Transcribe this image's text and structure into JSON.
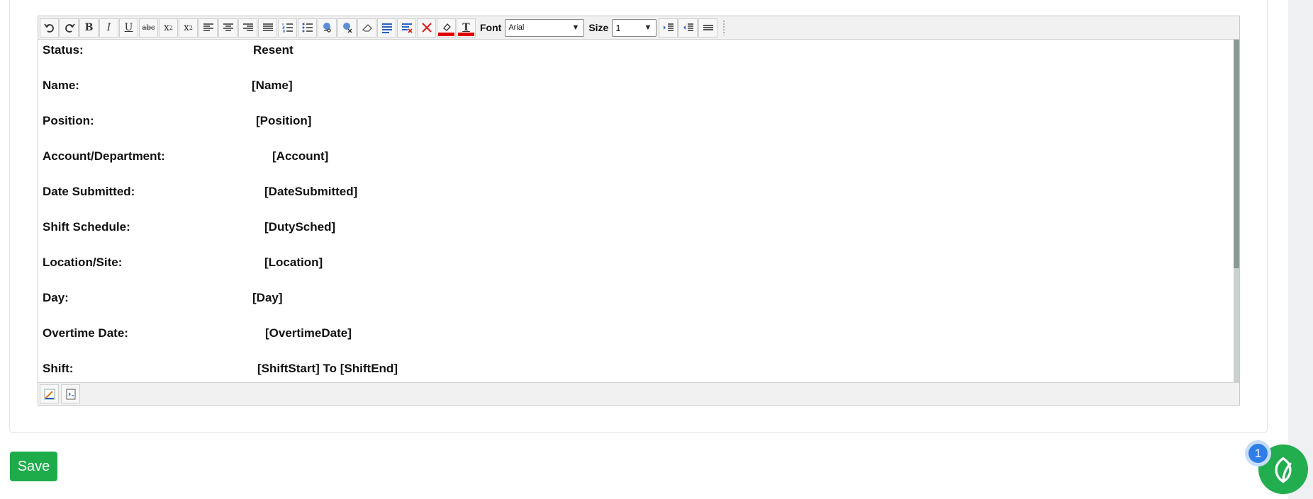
{
  "toolbar": {
    "font_label": "Font",
    "font_value": "Arial",
    "size_label": "Size",
    "size_value": "1",
    "text_color": "#e00000",
    "highlight_color": "#e00000"
  },
  "fields": [
    {
      "label": "Status:",
      "value": "Resent"
    },
    {
      "label": "Name:",
      "value": "[Name]"
    },
    {
      "label": "Position:",
      "value": "[Position]"
    },
    {
      "label": "Account/Department:",
      "value": "[Account]"
    },
    {
      "label": "Date Submitted:",
      "value": "[DateSubmitted]"
    },
    {
      "label": "Shift Schedule:",
      "value": "[DutySched]"
    },
    {
      "label": "Location/Site:",
      "value": "[Location]"
    },
    {
      "label": "Day:",
      "value": "[Day]"
    },
    {
      "label": "Overtime Date:",
      "value": "[OvertimeDate]"
    },
    {
      "label": "Shift:",
      "value": "[ShiftStart] To [ShiftEnd]"
    }
  ],
  "actions": {
    "save_label": "Save"
  },
  "chat": {
    "badge_count": "1",
    "brand_color": "#22ad4f"
  }
}
